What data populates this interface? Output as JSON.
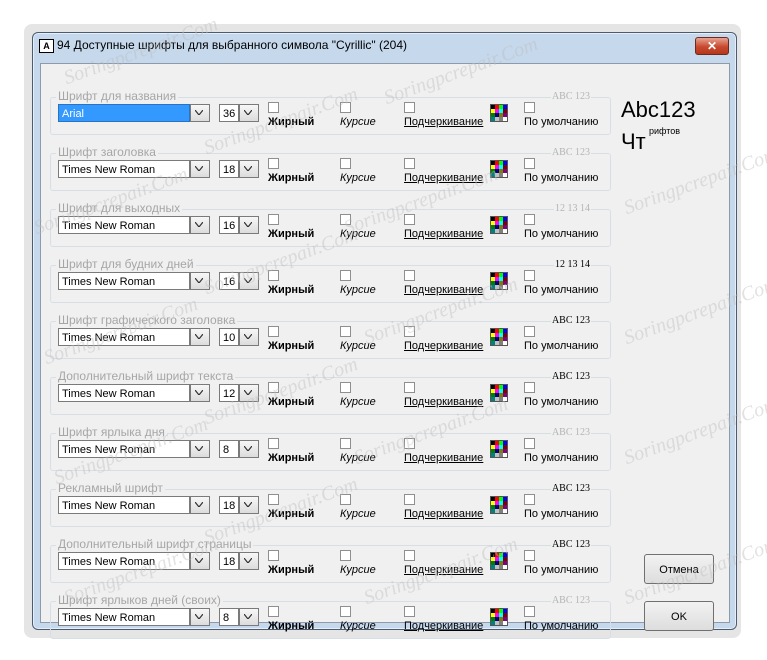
{
  "window": {
    "icon_glyph": "A",
    "title": "94 Доступные шрифты для выбранного символа \"Cyrillic\" (204)",
    "close_glyph": "✕"
  },
  "options": {
    "bold": "Жирный",
    "italic": "Курсие",
    "underline": "Подчеркивание",
    "default": "По умолчанию"
  },
  "groups": [
    {
      "title": "Шрифт для названия",
      "font": "Arial",
      "size": "36",
      "sample": "ABC 123",
      "sample_style": "dim",
      "selected": true
    },
    {
      "title": "Шрифт заголовка",
      "font": "Times New Roman",
      "size": "18",
      "sample": "ABC 123",
      "sample_style": "dim",
      "selected": false
    },
    {
      "title": "Шрифт для выходных",
      "font": "Times New Roman",
      "size": "16",
      "sample": "12 13 14",
      "sample_style": "dim",
      "selected": false
    },
    {
      "title": "Шрифт для будних дней",
      "font": "Times New Roman",
      "size": "16",
      "sample": "12 13 14",
      "sample_style": "dark",
      "selected": false
    },
    {
      "title": "Шрифт графического заголовка",
      "font": "Times New Roman",
      "size": "10",
      "sample": "ABC 123",
      "sample_style": "dark",
      "selected": false
    },
    {
      "title": "Дополнительный шрифт текста",
      "font": "Times New Roman",
      "size": "12",
      "sample": "ABC 123",
      "sample_style": "dark",
      "selected": false
    },
    {
      "title": "Шрифт ярлыка дня",
      "font": "Times New Roman",
      "size": "8",
      "sample": "ABC 123",
      "sample_style": "dim",
      "selected": false
    },
    {
      "title": "Рекламный шрифт",
      "font": "Times New Roman",
      "size": "18",
      "sample": "ABC 123",
      "sample_style": "dark",
      "selected": false
    },
    {
      "title": "Дополнительный шрифт страницы",
      "font": "Times New Roman",
      "size": "18",
      "sample": "ABC 123",
      "sample_style": "dark",
      "selected": false
    },
    {
      "title": "Шрифт ярлыков дней (своих)",
      "font": "Times New Roman",
      "size": "8",
      "sample": "ABC 123",
      "sample_style": "dim",
      "selected": false
    }
  ],
  "preview": {
    "line1": "Abc123",
    "line2": "Чт",
    "small": "рифтов"
  },
  "buttons": {
    "cancel": "Отмена",
    "ok": "OK"
  },
  "watermark": "Soringpcrepair.Com",
  "palette": [
    "#000000",
    "#ff0000",
    "#00ff00",
    "#0000ff",
    "#ffff00",
    "#ff00ff",
    "#00ffff",
    "#800000",
    "#008000",
    "#000080",
    "#808000",
    "#800080",
    "#008080",
    "#c0c0c0",
    "#808080",
    "#ffffff"
  ]
}
